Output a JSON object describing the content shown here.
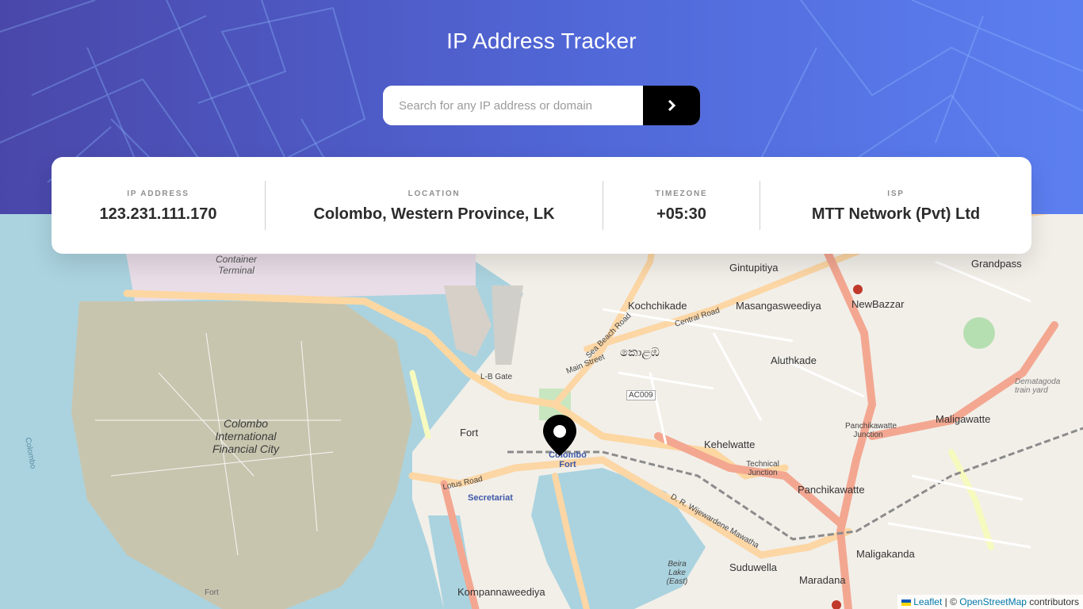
{
  "header": {
    "title": "IP Address Tracker",
    "colors": {
      "gradient_start": "#4a47a9",
      "gradient_end": "#5c7ff0"
    }
  },
  "search": {
    "placeholder": "Search for any IP address or domain",
    "value": "",
    "submit_icon": "chevron-right-icon"
  },
  "info": {
    "ip": {
      "label": "IP ADDRESS",
      "value": "123.231.111.170"
    },
    "location": {
      "label": "LOCATION",
      "value": "Colombo, Western Province, LK"
    },
    "timezone": {
      "label": "TIMEZONE",
      "value": "+05:30"
    },
    "isp": {
      "label": "ISP",
      "value": "MTT Network (Pvt) Ltd"
    }
  },
  "map": {
    "marker_icon": "location-pin-icon",
    "labels": {
      "container_terminal": "Container Terminal",
      "financial_city": "Colombo International Financial City",
      "gintupitiya": "Gintupitiya",
      "kochchikade": "Kochchikade",
      "masangasweediya": "Masangasweediya",
      "newbazzar": "NewBazzar",
      "grandpass": "Grandpass",
      "kolamba": "කොළඹ",
      "aluthkade": "Aluthkade",
      "kehelwatte": "Kehelwatte",
      "maligawatte": "Maligawatte",
      "panchikawatte": "Panchikawatte",
      "fort": "Fort",
      "colombo_fort": "Colombo Fort",
      "secretariat": "Secretariat",
      "lotus_road": "Lotus Road",
      "main_street": "Main Street",
      "central_road": "Central Road",
      "sea_beach_road": "Sea Beach Road",
      "technical_junction": "Technical Junction",
      "beira_lake": "Beira Lake (East)",
      "suduwella": "Suduwella",
      "maligakanda": "Maligakanda",
      "maradana": "Maradana",
      "kompannaweediya": "Kompannaweediya",
      "lb_gate": "L-B Gate",
      "ac009": "AC009",
      "dr_wijewardene": "D. R. Wijewardene Mawatha",
      "panchikawatte_junction": "Panchikawatte Junction",
      "demata_train_yard": "Dematagoda train yard",
      "colombo_vertical": "Colombo",
      "fort_bottom": "Fort"
    }
  },
  "attribution": {
    "leaflet": "Leaflet",
    "separator": " | © ",
    "osm": "OpenStreetMap",
    "contributors": " contributors"
  }
}
